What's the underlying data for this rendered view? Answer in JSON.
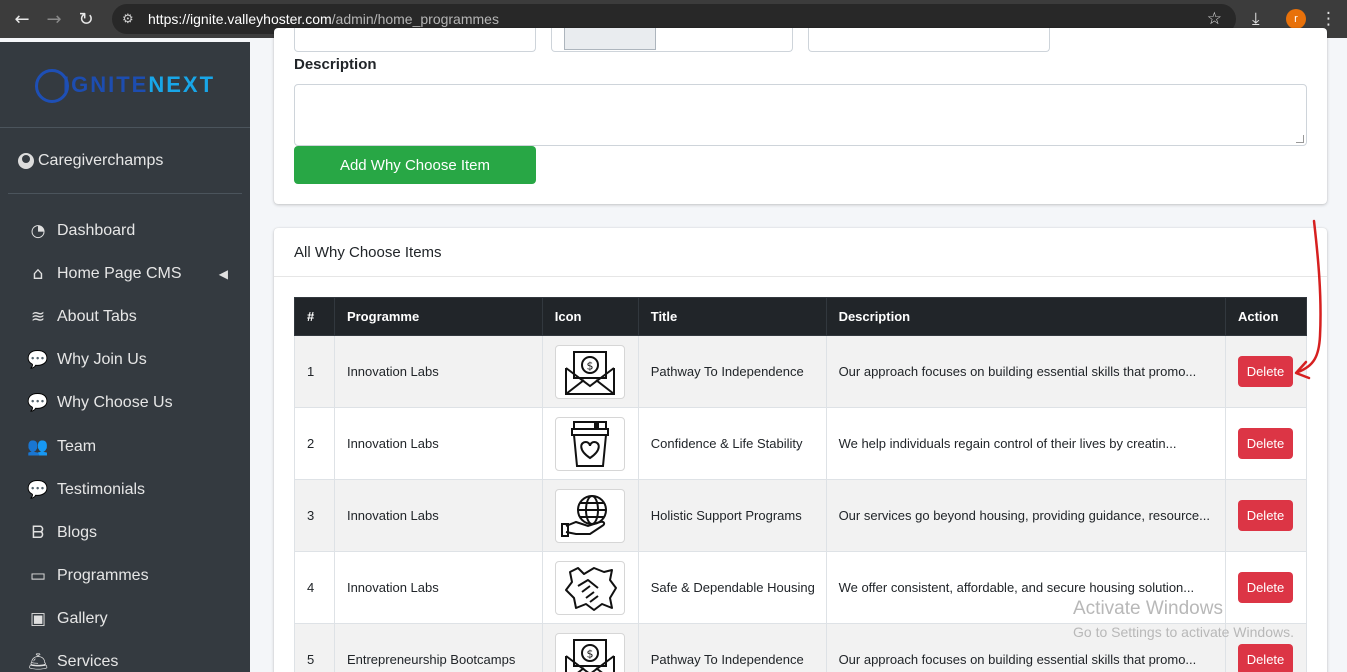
{
  "browser": {
    "url_host": "https://ignite.valleyhoster.com",
    "url_path": "/admin/home_programmes",
    "profile_initial": "r",
    "icons": [
      "back-arrow-icon",
      "forward-arrow-icon",
      "reload-icon",
      "site-info-icon",
      "bookmark-star-icon",
      "download-icon",
      "kebab-menu-icon"
    ]
  },
  "sidebar": {
    "brand_ignite": "IGNITE",
    "brand_next": "NEXT",
    "user_name": "Caregiverchamps",
    "items": [
      {
        "label": "Dashboard",
        "icon": "gauge-icon",
        "glyph": "◔"
      },
      {
        "label": "Home Page CMS",
        "icon": "home-icon",
        "glyph": "⌂"
      },
      {
        "label": "About Tabs",
        "icon": "layers-icon",
        "glyph": "≋"
      },
      {
        "label": "Why Join Us",
        "icon": "comments-icon",
        "glyph": "💬"
      },
      {
        "label": "Why Choose Us",
        "icon": "comments-icon",
        "glyph": "💬"
      },
      {
        "label": "Team",
        "icon": "users-icon",
        "glyph": "👥"
      },
      {
        "label": "Testimonials",
        "icon": "comments-icon",
        "glyph": "💬"
      },
      {
        "label": "Blogs",
        "icon": "blog-icon",
        "glyph": "ᗷ"
      },
      {
        "label": "Programmes",
        "icon": "chalkboard-icon",
        "glyph": "▭"
      },
      {
        "label": "Gallery",
        "icon": "images-icon",
        "glyph": "▣"
      },
      {
        "label": "Services",
        "icon": "concierge-bell-icon",
        "glyph": "🛎"
      }
    ]
  },
  "form": {
    "description_label": "Description",
    "description_value": "",
    "add_button": "Add Why Choose Item"
  },
  "list": {
    "header": "All Why Choose Items",
    "columns": [
      "#",
      "Programme",
      "Icon",
      "Title",
      "Description",
      "Action"
    ],
    "rows": [
      {
        "num": "1",
        "programme": "Innovation Labs",
        "icon": "money-envelope-icon",
        "title": "Pathway To Independence",
        "description": "Our approach focuses on building essential skills that promo...",
        "action": "Delete"
      },
      {
        "num": "2",
        "programme": "Innovation Labs",
        "icon": "heart-jar-icon",
        "title": "Confidence & Life Stability",
        "description": "We help individuals regain control of their lives by creatin...",
        "action": "Delete"
      },
      {
        "num": "3",
        "programme": "Innovation Labs",
        "icon": "globe-hand-icon",
        "title": "Holistic Support Programs",
        "description": "Our services go beyond housing, providing guidance, resource...",
        "action": "Delete"
      },
      {
        "num": "4",
        "programme": "Innovation Labs",
        "icon": "handshake-icon",
        "title": "Safe & Dependable Housing",
        "description": "We offer consistent, affordable, and secure housing solution...",
        "action": "Delete"
      },
      {
        "num": "5",
        "programme": "Entrepreneurship Bootcamps",
        "icon": "money-envelope-icon",
        "title": "Pathway To Independence",
        "description": "Our approach focuses on building essential skills that promo...",
        "action": "Delete"
      }
    ]
  },
  "watermark": {
    "title": "Activate Windows",
    "subtitle": "Go to Settings to activate Windows."
  },
  "colors": {
    "sidebar_bg": "#343a40",
    "add_button": "#28a745",
    "delete_button": "#dc3545",
    "table_head": "#212529",
    "annotation_arrow": "#d62020"
  }
}
